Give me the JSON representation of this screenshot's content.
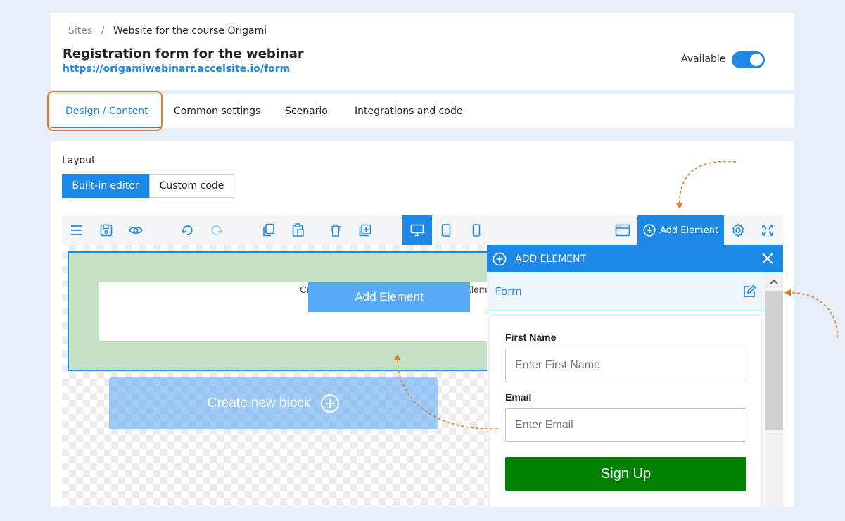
{
  "breadcrumb": {
    "root": "Sites",
    "separator": "/",
    "current": "Website for the course Origami"
  },
  "page": {
    "title": "Registration form for the webinar",
    "url": "https://origamiwebinarr.accelsite.io/form"
  },
  "availability": {
    "label": "Available",
    "enabled": true
  },
  "tabs": [
    {
      "label": "Design / Content",
      "active": true
    },
    {
      "label": "Common settings",
      "active": false
    },
    {
      "label": "Scenario",
      "active": false
    },
    {
      "label": "Integrations and code",
      "active": false
    }
  ],
  "layout": {
    "label": "Layout",
    "options": [
      "Built-in editor",
      "Custom code"
    ],
    "selected": "Built-in editor"
  },
  "toolbar": {
    "icons": [
      "menu-icon",
      "save-icon",
      "preview-eye-icon",
      "undo-icon",
      "redo-icon",
      "copy-icon",
      "paste-icon",
      "delete-icon",
      "duplicate-icon",
      "desktop-icon",
      "tablet-icon",
      "mobile-icon",
      "browser-window-icon",
      "settings-gear-icon",
      "fullscreen-icon"
    ],
    "add_element_label": "Add Element"
  },
  "canvas": {
    "placeholder_text": "Create New Element here! Click 'Add Element'",
    "add_element_button": "Add Element",
    "create_block_label": "Create new block"
  },
  "panel": {
    "title": "ADD ELEMENT",
    "section": "Form",
    "form": {
      "first_name_label": "First Name",
      "first_name_placeholder": "Enter First Name",
      "email_label": "Email",
      "email_placeholder": "Enter Email",
      "submit_label": "Sign Up"
    }
  },
  "colors": {
    "accent": "#1e88e5",
    "highlight": "#e07b2c",
    "submit": "#008000",
    "block": "#c5e3c4"
  }
}
